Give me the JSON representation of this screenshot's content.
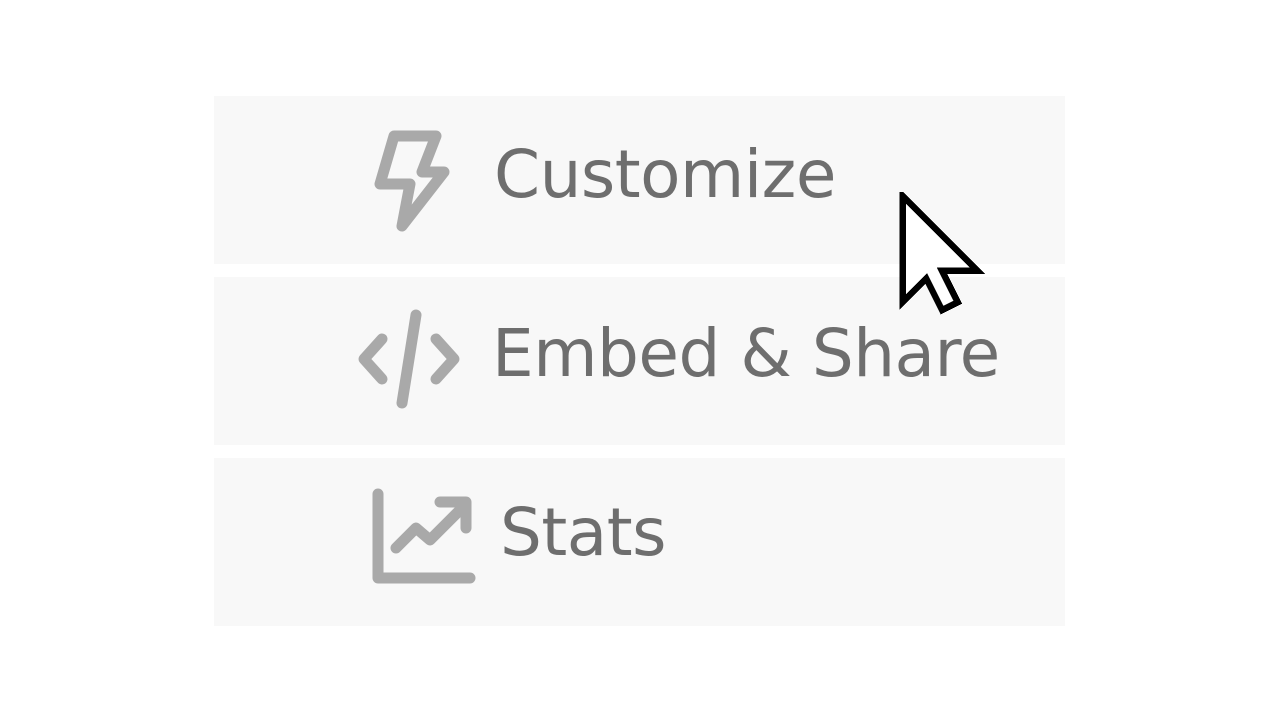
{
  "menu": {
    "items": [
      {
        "label": "Customize",
        "icon": "lightning-bolt-icon"
      },
      {
        "label": "Embed & Share",
        "icon": "code-icon"
      },
      {
        "label": "Stats",
        "icon": "trending-up-chart-icon"
      }
    ]
  },
  "colors": {
    "item_background": "#f8f8f8",
    "icon": "#a9a9a9",
    "label": "#6e6e6e",
    "page_background": "#ffffff"
  },
  "cursor": {
    "icon": "arrow-cursor-icon"
  }
}
